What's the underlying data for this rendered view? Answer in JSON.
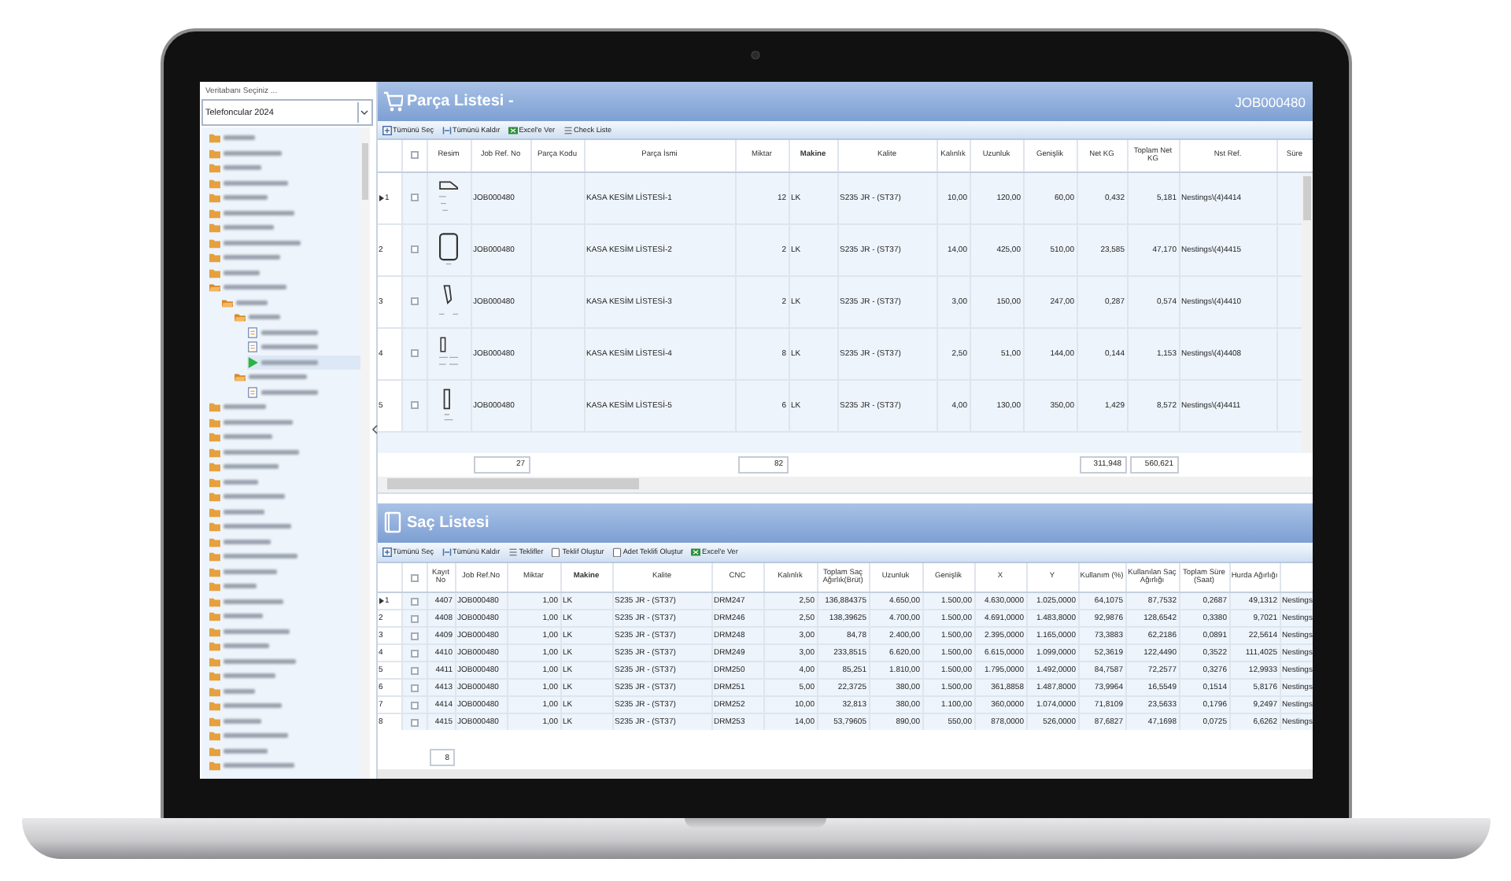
{
  "sidebar": {
    "group_label": "Veritabanı Seçiniz ...",
    "database": "Telefoncular 2024",
    "tree": [
      {
        "kind": "folder",
        "expanded": false
      },
      {
        "kind": "folder",
        "expanded": false
      },
      {
        "kind": "folder",
        "expanded": false
      },
      {
        "kind": "folder",
        "expanded": false
      },
      {
        "kind": "folder",
        "expanded": false
      },
      {
        "kind": "folder",
        "expanded": false
      },
      {
        "kind": "folder",
        "expanded": false
      },
      {
        "kind": "folder",
        "expanded": false
      },
      {
        "kind": "folder",
        "expanded": false
      },
      {
        "kind": "folder",
        "expanded": false
      },
      {
        "kind": "folder",
        "expanded": true,
        "children": [
          {
            "kind": "folder",
            "expanded": true,
            "children": [
              {
                "kind": "folder",
                "expanded": true,
                "children": [
                  {
                    "kind": "file",
                    "selected": false
                  },
                  {
                    "kind": "file",
                    "selected": false
                  },
                  {
                    "kind": "file",
                    "selected": true
                  }
                ]
              },
              {
                "kind": "folder",
                "expanded": true,
                "children": [
                  {
                    "kind": "file",
                    "selected": false
                  }
                ]
              }
            ]
          }
        ]
      },
      {
        "kind": "folder",
        "expanded": false
      },
      {
        "kind": "folder",
        "expanded": false
      },
      {
        "kind": "folder",
        "expanded": false
      },
      {
        "kind": "folder",
        "expanded": false
      },
      {
        "kind": "folder",
        "expanded": false
      },
      {
        "kind": "folder",
        "expanded": false
      },
      {
        "kind": "folder",
        "expanded": false
      },
      {
        "kind": "folder",
        "expanded": false
      },
      {
        "kind": "folder",
        "expanded": false
      },
      {
        "kind": "folder",
        "expanded": false
      },
      {
        "kind": "folder",
        "expanded": false
      },
      {
        "kind": "folder",
        "expanded": false
      },
      {
        "kind": "folder",
        "expanded": false
      },
      {
        "kind": "folder",
        "expanded": false
      },
      {
        "kind": "folder",
        "expanded": false
      },
      {
        "kind": "folder",
        "expanded": false
      },
      {
        "kind": "folder",
        "expanded": false
      },
      {
        "kind": "folder",
        "expanded": false
      },
      {
        "kind": "folder",
        "expanded": false
      },
      {
        "kind": "folder",
        "expanded": false
      },
      {
        "kind": "folder",
        "expanded": false
      },
      {
        "kind": "folder",
        "expanded": false
      },
      {
        "kind": "folder",
        "expanded": false
      },
      {
        "kind": "folder",
        "expanded": false
      },
      {
        "kind": "folder",
        "expanded": false
      }
    ]
  },
  "parts": {
    "title": "Parça Listesi -",
    "job": "JOB000480",
    "toolbar": [
      {
        "label": "Tümünü Seç"
      },
      {
        "label": "Tümünü Kaldır"
      },
      {
        "label": "Excel'e Ver"
      },
      {
        "label": "Check Liste"
      }
    ],
    "header_checked": false,
    "columns": [
      {
        "label": "Resim",
        "kind": "image",
        "bold": false
      },
      {
        "label": "Job Ref. No",
        "kind": "text",
        "bold": false,
        "total": "27"
      },
      {
        "label": "Parça Kodu",
        "kind": "text",
        "bold": false
      },
      {
        "label": "Parça İsmi",
        "kind": "text",
        "bold": false
      },
      {
        "label": "Miktar",
        "kind": "number",
        "bold": false,
        "total": "82"
      },
      {
        "label": "Makine",
        "kind": "text",
        "bold": true
      },
      {
        "label": "Kalite",
        "kind": "text",
        "bold": false
      },
      {
        "label": "Kalınlık",
        "kind": "number",
        "bold": false
      },
      {
        "label": "Uzunluk",
        "kind": "number",
        "bold": false
      },
      {
        "label": "Genişlik",
        "kind": "number",
        "bold": false
      },
      {
        "label": "Net KG",
        "kind": "number",
        "bold": false,
        "total": "311,948"
      },
      {
        "label": "Toplam Net KG",
        "kind": "number",
        "bold": false,
        "total": "560,621"
      },
      {
        "label": "Nst Ref.",
        "kind": "text",
        "bold": false
      },
      {
        "label": "Süre",
        "kind": "text",
        "bold": false
      }
    ],
    "rows": [
      {
        "number": "1",
        "current": true,
        "checked": false,
        "cells": [
          "",
          "JOB000480",
          "",
          "KASA KESİM LİSTESİ-1",
          "12",
          "LK",
          "S235 JR - (ST37)",
          "10,00",
          "120,00",
          "60,00",
          "0,432",
          "5,181",
          "Nestings\\(4)4414",
          ""
        ]
      },
      {
        "number": "2",
        "current": false,
        "checked": false,
        "cells": [
          "",
          "JOB000480",
          "",
          "KASA KESİM LİSTESİ-2",
          "2",
          "LK",
          "S235 JR - (ST37)",
          "14,00",
          "425,00",
          "510,00",
          "23,585",
          "47,170",
          "Nestings\\(4)4415",
          ""
        ]
      },
      {
        "number": "3",
        "current": false,
        "checked": false,
        "cells": [
          "",
          "JOB000480",
          "",
          "KASA KESİM LİSTESİ-3",
          "2",
          "LK",
          "S235 JR - (ST37)",
          "3,00",
          "150,00",
          "247,00",
          "0,287",
          "0,574",
          "Nestings\\(4)4410",
          ""
        ]
      },
      {
        "number": "4",
        "current": false,
        "checked": false,
        "cells": [
          "",
          "JOB000480",
          "",
          "KASA KESİM LİSTESİ-4",
          "8",
          "LK",
          "S235 JR - (ST37)",
          "2,50",
          "51,00",
          "144,00",
          "0,144",
          "1,153",
          "Nestings\\(4)4408",
          ""
        ]
      },
      {
        "number": "5",
        "current": false,
        "checked": false,
        "cells": [
          "",
          "JOB000480",
          "",
          "KASA KESİM LİSTESİ-5",
          "6",
          "LK",
          "S235 JR - (ST37)",
          "4,00",
          "130,00",
          "350,00",
          "1,429",
          "8,572",
          "Nestings\\(4)4411",
          ""
        ]
      }
    ]
  },
  "sheets": {
    "title": "Saç Listesi",
    "toolbar": [
      {
        "label": "Tümünü Seç"
      },
      {
        "label": "Tümünü Kaldır"
      },
      {
        "label": "Teklifler"
      },
      {
        "label": "Teklif Oluştur"
      },
      {
        "label": "Adet Teklifi Oluştur"
      },
      {
        "label": "Excel'e Ver"
      }
    ],
    "header_checked": false,
    "columns": [
      {
        "label": "Kayıt No",
        "kind": "number",
        "bold": false,
        "total": "8"
      },
      {
        "label": "Job Ref.No",
        "kind": "text",
        "bold": false
      },
      {
        "label": "Miktar",
        "kind": "number",
        "bold": false
      },
      {
        "label": "Makine",
        "kind": "text",
        "bold": true
      },
      {
        "label": "Kalite",
        "kind": "text",
        "bold": false
      },
      {
        "label": "CNC",
        "kind": "text",
        "bold": false
      },
      {
        "label": "Kalınlık",
        "kind": "number",
        "bold": false
      },
      {
        "label": "Toplam Saç Ağırlık(Brüt)",
        "kind": "number",
        "bold": false
      },
      {
        "label": "Uzunluk",
        "kind": "number",
        "bold": false
      },
      {
        "label": "Genişlik",
        "kind": "number",
        "bold": false
      },
      {
        "label": "X",
        "kind": "number",
        "bold": false
      },
      {
        "label": "Y",
        "kind": "number",
        "bold": false
      },
      {
        "label": "Kullanım (%)",
        "kind": "number",
        "bold": false
      },
      {
        "label": "Kullanılan Saç Ağırlığı",
        "kind": "number",
        "bold": false
      },
      {
        "label": "Toplam Süre (Saat)",
        "kind": "number",
        "bold": false
      },
      {
        "label": "Hurda Ağırlığı",
        "kind": "number",
        "bold": false
      },
      {
        "kind": "text"
      }
    ],
    "rows": [
      {
        "number": "1",
        "current": true,
        "checked": false,
        "cells": [
          "4407",
          "JOB000480",
          "1,00",
          "LK",
          "S235 JR - (ST37)",
          "DRM247",
          "2,50",
          "136,884375",
          "4.650,00",
          "1.500,00",
          "4.630,0000",
          "1.025,0000",
          "64,1075",
          "87,7532",
          "0,2687",
          "49,1312",
          "Nestings"
        ]
      },
      {
        "number": "2",
        "current": false,
        "checked": false,
        "cells": [
          "4408",
          "JOB000480",
          "1,00",
          "LK",
          "S235 JR - (ST37)",
          "DRM246",
          "2,50",
          "138,39625",
          "4.700,00",
          "1.500,00",
          "4.691,0000",
          "1.483,8000",
          "92,9876",
          "128,6542",
          "0,3380",
          "9,7021",
          "Nestings"
        ]
      },
      {
        "number": "3",
        "current": false,
        "checked": false,
        "cells": [
          "4409",
          "JOB000480",
          "1,00",
          "LK",
          "S235 JR - (ST37)",
          "DRM248",
          "3,00",
          "84,78",
          "2.400,00",
          "1.500,00",
          "2.395,0000",
          "1.165,0000",
          "73,3883",
          "62,2186",
          "0,0891",
          "22,5614",
          "Nestings"
        ]
      },
      {
        "number": "4",
        "current": false,
        "checked": false,
        "cells": [
          "4410",
          "JOB000480",
          "1,00",
          "LK",
          "S235 JR - (ST37)",
          "DRM249",
          "3,00",
          "233,8515",
          "6.620,00",
          "1.500,00",
          "6.615,0000",
          "1.099,0000",
          "52,3619",
          "122,4490",
          "0,3522",
          "111,4025",
          "Nestings"
        ]
      },
      {
        "number": "5",
        "current": false,
        "checked": false,
        "cells": [
          "4411",
          "JOB000480",
          "1,00",
          "LK",
          "S235 JR - (ST37)",
          "DRM250",
          "4,00",
          "85,251",
          "1.810,00",
          "1.500,00",
          "1.795,0000",
          "1.492,0000",
          "84,7587",
          "72,2577",
          "0,3276",
          "12,9933",
          "Nestings"
        ]
      },
      {
        "number": "6",
        "current": false,
        "checked": false,
        "cells": [
          "4413",
          "JOB000480",
          "1,00",
          "LK",
          "S235 JR - (ST37)",
          "DRM251",
          "5,00",
          "22,3725",
          "380,00",
          "1.500,00",
          "361,8858",
          "1.487,8000",
          "73,9964",
          "16,5549",
          "0,1514",
          "5,8176",
          "Nestings"
        ]
      },
      {
        "number": "7",
        "current": false,
        "checked": false,
        "cells": [
          "4414",
          "JOB000480",
          "1,00",
          "LK",
          "S235 JR - (ST37)",
          "DRM252",
          "10,00",
          "32,813",
          "380,00",
          "1.100,00",
          "360,0000",
          "1.074,0000",
          "71,8109",
          "23,5633",
          "0,1796",
          "9,2497",
          "Nestings"
        ]
      },
      {
        "number": "8",
        "current": false,
        "checked": false,
        "cells": [
          "4415",
          "JOB000480",
          "1,00",
          "LK",
          "S235 JR - (ST37)",
          "DRM253",
          "14,00",
          "53,79605",
          "890,00",
          "550,00",
          "878,0000",
          "526,0000",
          "87,6827",
          "47,1698",
          "0,0725",
          "6,6262",
          "Nestings"
        ]
      }
    ]
  }
}
